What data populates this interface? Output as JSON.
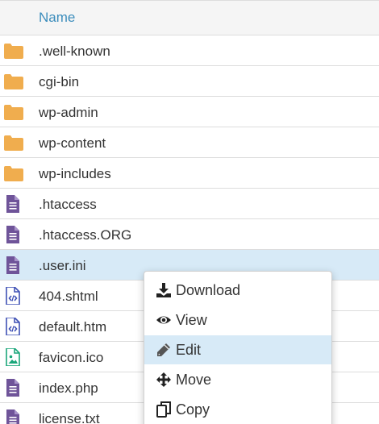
{
  "table": {
    "header": {
      "name": "Name"
    },
    "rows": [
      {
        "name": ".well-known",
        "icon": "folder-icon"
      },
      {
        "name": "cgi-bin",
        "icon": "folder-icon"
      },
      {
        "name": "wp-admin",
        "icon": "folder-icon"
      },
      {
        "name": "wp-content",
        "icon": "folder-icon"
      },
      {
        "name": "wp-includes",
        "icon": "folder-icon"
      },
      {
        "name": ".htaccess",
        "icon": "text-file-icon"
      },
      {
        "name": ".htaccess.ORG",
        "icon": "text-file-icon"
      },
      {
        "name": ".user.ini",
        "icon": "text-file-icon",
        "selected": true
      },
      {
        "name": "404.shtml",
        "icon": "code-file-icon"
      },
      {
        "name": "default.htm",
        "icon": "code-file-icon"
      },
      {
        "name": "favicon.ico",
        "icon": "image-file-icon"
      },
      {
        "name": "index.php",
        "icon": "text-file-icon"
      },
      {
        "name": "license.txt",
        "icon": "text-file-icon"
      }
    ]
  },
  "context_menu": {
    "items": [
      {
        "label": "Download",
        "icon": "download-icon"
      },
      {
        "label": "View",
        "icon": "eye-icon"
      },
      {
        "label": "Edit",
        "icon": "pencil-icon",
        "active": true
      },
      {
        "label": "Move",
        "icon": "move-arrows-icon"
      },
      {
        "label": "Copy",
        "icon": "copy-icon"
      }
    ]
  },
  "colors": {
    "folder": "#f0ad4e",
    "text_file": "#6f5499",
    "code_file": "#3f51b5",
    "image_file": "#1aa67a",
    "header_text": "#3c8dbc",
    "selected_row": "#d7eaf7"
  }
}
